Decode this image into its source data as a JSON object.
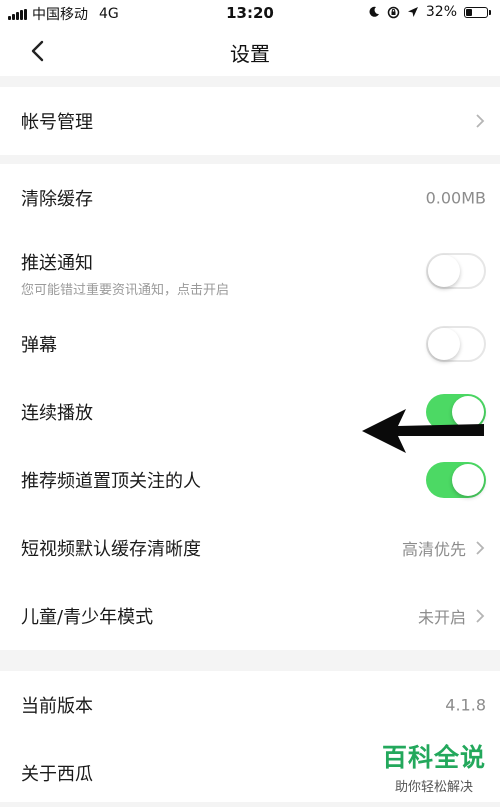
{
  "status_bar": {
    "carrier": "中国移动",
    "network": "4G",
    "time": "13:20",
    "battery": "32%",
    "battery_level": 0.32
  },
  "nav": {
    "title": "设置"
  },
  "account": {
    "label": "帐号管理"
  },
  "settings": {
    "clear_cache": {
      "label": "清除缓存",
      "value": "0.00MB"
    },
    "push": {
      "label": "推送通知",
      "sub": "您可能错过重要资讯通知，点击开启",
      "on": false
    },
    "danmaku": {
      "label": "弹幕",
      "on": false
    },
    "autoplay": {
      "label": "连续播放",
      "on": true
    },
    "pin_follow": {
      "label": "推荐频道置顶关注的人",
      "on": true
    },
    "cache_quality": {
      "label": "短视频默认缓存清晰度",
      "value": "高清优先"
    },
    "kids_mode": {
      "label": "儿童/青少年模式",
      "value": "未开启"
    }
  },
  "about": {
    "version": {
      "label": "当前版本",
      "value": "4.1.8"
    },
    "about_app": {
      "label": "关于西瓜"
    }
  },
  "watermark": {
    "title": "百科全说",
    "subtitle": "助你轻松解决"
  },
  "colors": {
    "toggle_on": "#4cd964",
    "watermark": "#23a85c"
  }
}
